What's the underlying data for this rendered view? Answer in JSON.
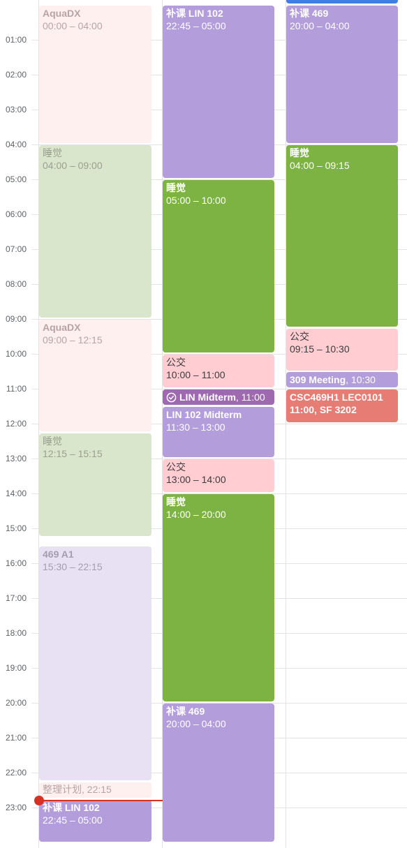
{
  "time_labels": [
    "01:00",
    "02:00",
    "03:00",
    "04:00",
    "05:00",
    "06:00",
    "07:00",
    "08:00",
    "09:00",
    "10:00",
    "11:00",
    "12:00",
    "13:00",
    "14:00",
    "15:00",
    "16:00",
    "17:00",
    "18:00",
    "19:00",
    "20:00",
    "21:00",
    "22:00",
    "23:00"
  ],
  "colors": {
    "lavender": "#b39ddb",
    "green": "#7cb342",
    "pink": "#ffcdd2",
    "red": "#e67c73",
    "grape": "#9e69af",
    "past_pink": "#fff0f0",
    "past_green": "#d9e6cc",
    "past_lavender": "#e8e1f4",
    "now": "#d93025"
  },
  "day1": [
    {
      "title": "AquaDX",
      "time": "00:00 – 04:00"
    },
    {
      "title": "睡觉",
      "time": "04:00 – 09:00"
    },
    {
      "title": "AquaDX",
      "time": "09:00 – 12:15"
    },
    {
      "title": "睡觉",
      "time": "12:15 – 15:15"
    },
    {
      "title": "469 A1",
      "time": "15:30 – 22:15"
    },
    {
      "title": "整理计划",
      "time": "22:15"
    },
    {
      "title": "补课 LIN 102",
      "time": "22:45 – 05:00"
    }
  ],
  "day2": [
    {
      "title": "补课 LIN 102",
      "time": "22:45 – 05:00"
    },
    {
      "title": "睡觉",
      "time": "05:00 – 10:00"
    },
    {
      "title": "公交",
      "time": "10:00 – 11:00"
    },
    {
      "title": "LIN Midterm",
      "time": "11:00"
    },
    {
      "title": "LIN 102 Midterm",
      "time": "11:30 – 13:00"
    },
    {
      "title": "公交",
      "time": "13:00 – 14:00"
    },
    {
      "title": "睡觉",
      "time": "14:00 – 20:00"
    },
    {
      "title": "补课 469",
      "time": "20:00 – 04:00"
    }
  ],
  "day3": [
    {
      "title": "补课 469",
      "time": "20:00 – 04:00"
    },
    {
      "title": "睡觉",
      "time": "04:00 – 09:15"
    },
    {
      "title": "公交",
      "time": "09:15 – 10:30"
    },
    {
      "title": "309 Meeting",
      "time": "10:30"
    },
    {
      "title": "CSC469H1 LEC0101",
      "time": "11:00, SF 3202"
    }
  ]
}
